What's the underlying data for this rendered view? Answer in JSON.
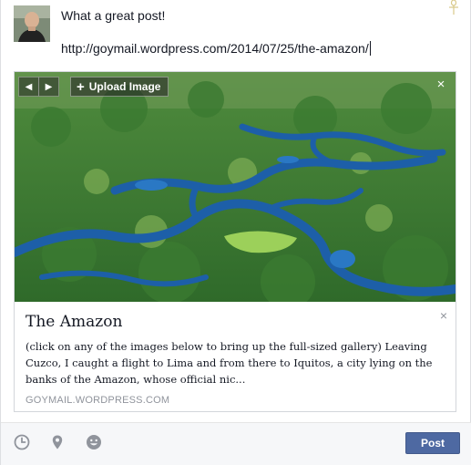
{
  "composer": {
    "text_line_1": "What a great post!",
    "text_line_2": "http://goymail.wordpress.com/2014/07/25/the-amazon/"
  },
  "attachment": {
    "nav_prev_icon": "triangle-left-icon",
    "nav_next_icon": "triangle-right-icon",
    "upload_label": "Upload Image",
    "upload_icon": "+",
    "close_icon": "×",
    "title": "The Amazon",
    "description": "(click on any of the images below to bring up the full-sized gallery) Leaving Cuzco, I caught a flight to Lima and from there to Iquitos, a city lying on the banks of the Amazon, whose official nic...",
    "domain": "GOYMAIL.WORDPRESS.COM"
  },
  "footer": {
    "icons": [
      "clock-icon",
      "location-pin-icon",
      "smiley-icon"
    ],
    "post_label": "Post"
  },
  "colors": {
    "post_button": "#4e69a2",
    "footer_bg": "#f6f7f9",
    "muted_text": "#90949c"
  }
}
